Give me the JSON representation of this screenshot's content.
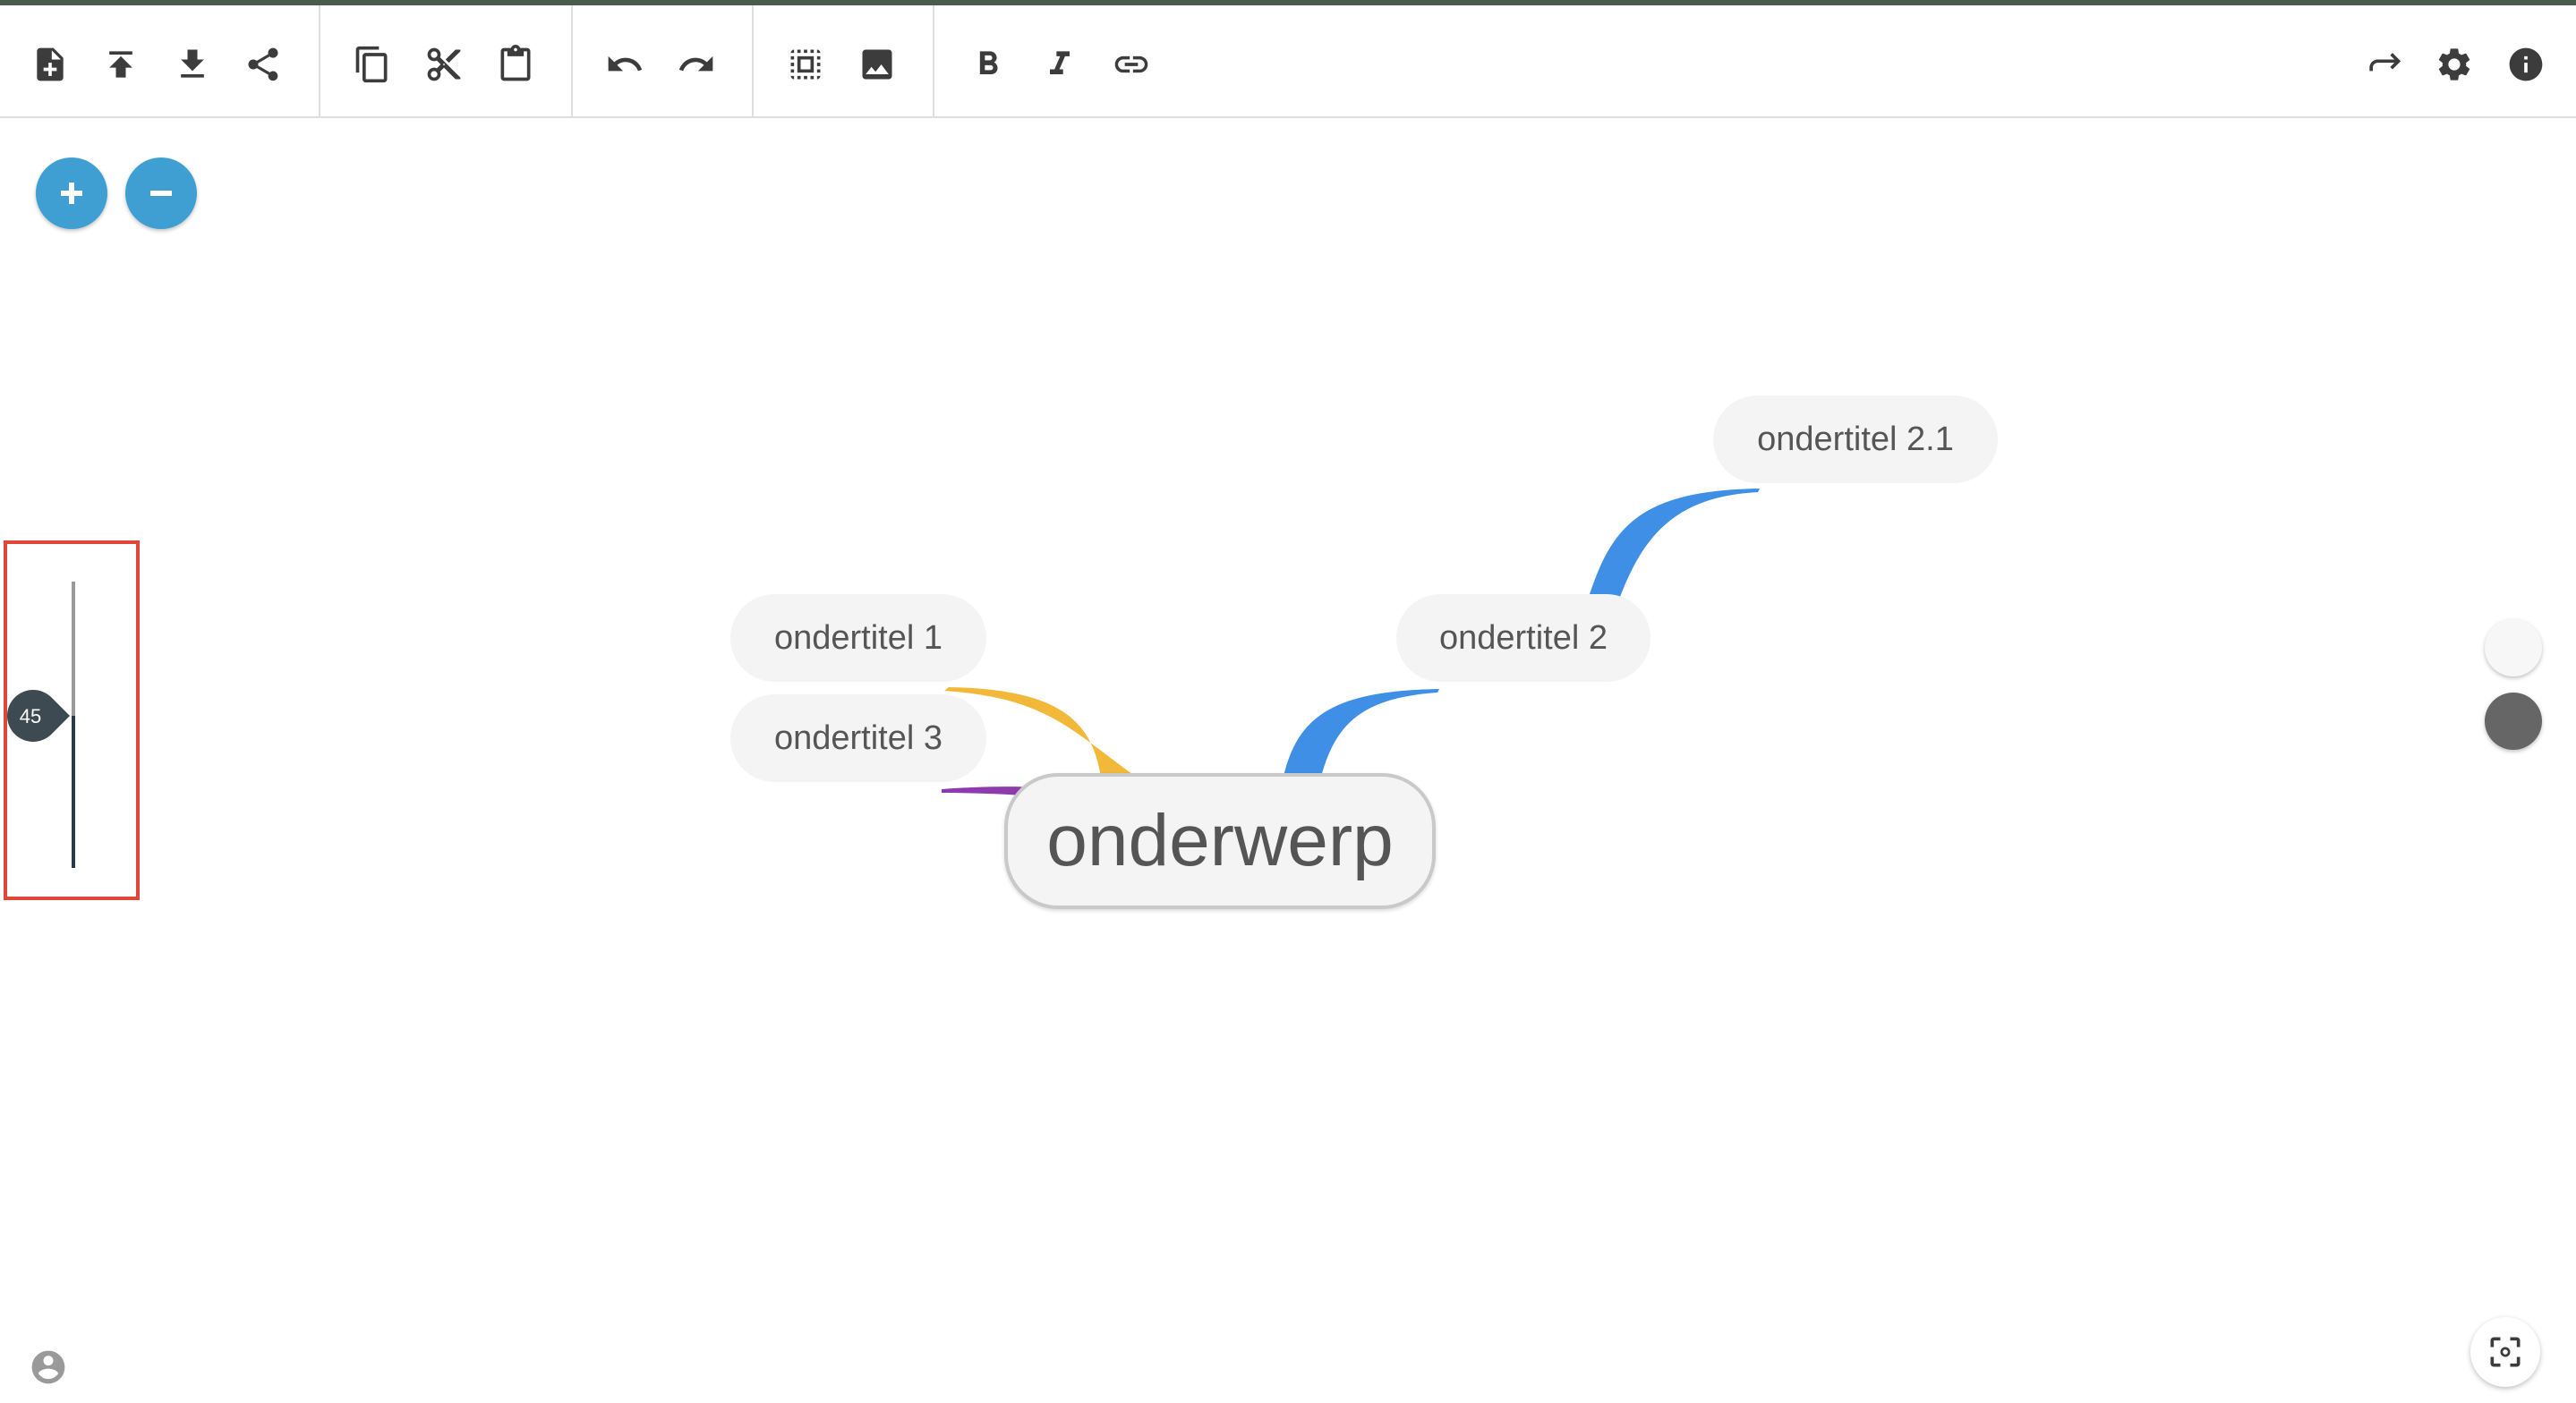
{
  "toolbar": {
    "groups": [
      [
        "new-file-icon",
        "upload-icon",
        "download-icon",
        "share-icon"
      ],
      [
        "copy-icon",
        "cut-icon",
        "paste-icon"
      ],
      [
        "undo-icon",
        "redo-icon"
      ],
      [
        "select-all-icon",
        "image-icon"
      ],
      [
        "bold-icon",
        "italic-icon",
        "link-icon"
      ]
    ],
    "right": [
      "forward-icon",
      "settings-icon",
      "info-icon"
    ]
  },
  "zoom_controls": {
    "in_icon": "plus-icon",
    "out_icon": "minus-icon"
  },
  "slider": {
    "value_label": "45",
    "value": 45,
    "fraction": 0.45
  },
  "mindmap": {
    "root": {
      "label": "onderwerp"
    },
    "children": [
      {
        "label": "ondertitel 1",
        "color": "#f2b83a"
      },
      {
        "label": "ondertitel 2",
        "color": "#3f8fe6",
        "children": [
          {
            "label": "ondertitel 2.1",
            "color": "#3f8fe6"
          }
        ]
      },
      {
        "label": "ondertitel 3",
        "color": "#8e3bb0"
      }
    ]
  },
  "theme": {
    "light_color": "#f7f7f7",
    "dark_color": "#666666"
  },
  "bottom": {
    "fit_icon": "fit-screen-icon",
    "user_icon": "user-icon"
  }
}
